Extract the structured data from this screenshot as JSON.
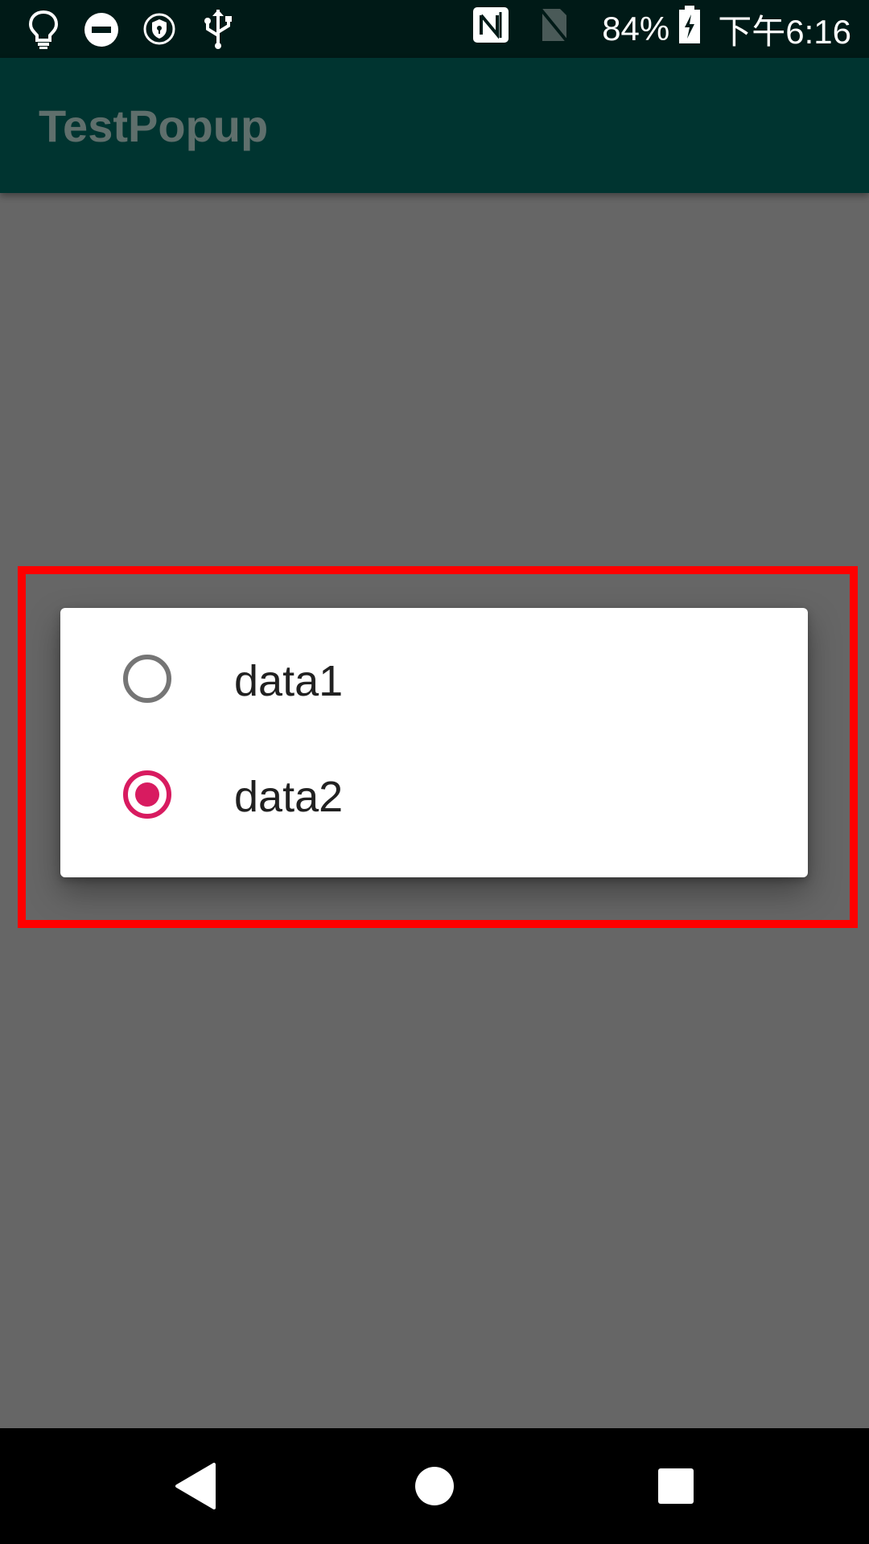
{
  "status_bar": {
    "battery": "84%",
    "time": "下午6:16",
    "left_icons": [
      "lightbulb-icon",
      "do-not-disturb-icon",
      "vpn-shield-icon",
      "usb-icon"
    ],
    "right_icons": [
      "nfc-icon",
      "no-sim-icon",
      "battery-charging-icon"
    ]
  },
  "app_bar": {
    "title": "TestPopup",
    "color": "#003430"
  },
  "popup": {
    "options": [
      {
        "label": "data1",
        "selected": false
      },
      {
        "label": "data2",
        "selected": true
      }
    ],
    "accent_color": "#d81b60",
    "highlight_color": "#ff0000"
  },
  "nav_bar": {
    "buttons": [
      "back-icon",
      "home-icon",
      "recents-icon"
    ]
  }
}
